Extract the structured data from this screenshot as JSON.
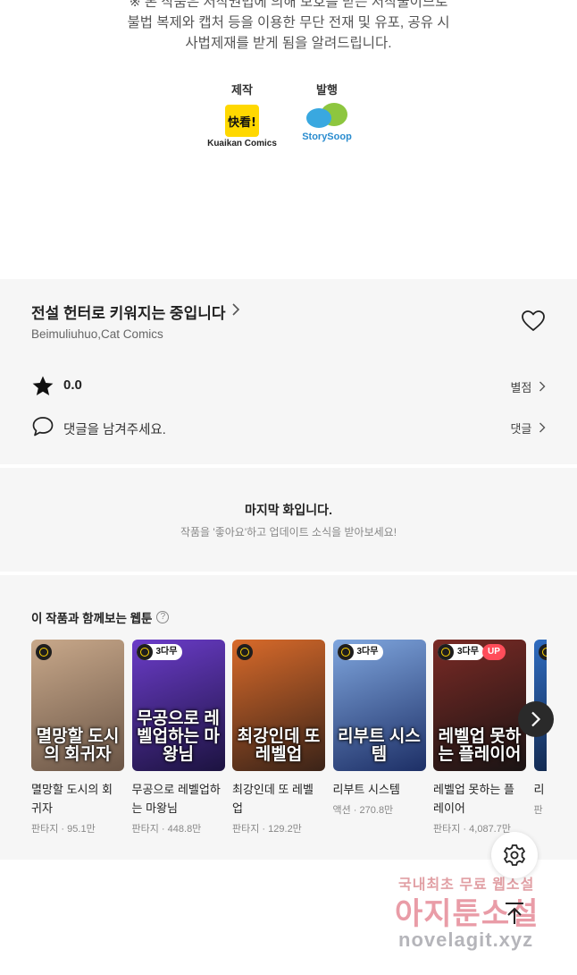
{
  "notice": {
    "lines": [
      "※ 본 작품은 저작권법에 의해 보호를 받는 저작물이므로",
      "불법 복제와 캡처 등을 이용한 무단 전재 및 유포, 공유 시",
      "사법제재를 받게 됨을 알려드립니다."
    ],
    "production_label": "제작",
    "production_logo_text": "快看!",
    "production_name": "Kuaikan Comics",
    "publisher_label": "발행",
    "publisher_name": "StorySoop"
  },
  "work": {
    "title": "전설 헌터로 키워지는 중입니다",
    "authors": "Beimuliuhuo,Cat Comics",
    "rating": "0.0",
    "rate_link": "별점",
    "comment_prompt": "댓글을 남겨주세요.",
    "comment_link": "댓글"
  },
  "last_episode": {
    "title": "마지막 화입니다.",
    "subtitle": "작품을 '좋아요'하고 업데이트 소식을 받아보세요!"
  },
  "recommendations": {
    "heading": "이 작품과 함께보는 웹툰",
    "items": [
      {
        "title": "멸망할 도시의 회귀자",
        "genre": "판타지",
        "views": "95.1만",
        "cover_text": "멸망할 도시의 회귀자",
        "badge": "",
        "up": "",
        "colors": [
          "#c8a88a",
          "#6a5546"
        ]
      },
      {
        "title": "무공으로 레벨업하는 마왕님",
        "genre": "판타지",
        "views": "448.8만",
        "cover_text": "무공으로 레벨업하는 마왕님",
        "badge": "3다무",
        "up": "",
        "colors": [
          "#6b3cc9",
          "#1c1340"
        ]
      },
      {
        "title": "최강인데 또 레벨업",
        "genre": "판타지",
        "views": "129.2만",
        "cover_text": "최강인데 또 레벨업",
        "badge": "",
        "up": "",
        "colors": [
          "#d86a2a",
          "#3a2318"
        ]
      },
      {
        "title": "리부트 시스템",
        "genre": "액션",
        "views": "270.8만",
        "cover_text": "리부트 시스템",
        "badge": "3다무",
        "up": "",
        "colors": [
          "#7fa6de",
          "#1d2f66"
        ]
      },
      {
        "title": "레벨업 못하는 플레이어",
        "genre": "판타지",
        "views": "4,087.7만",
        "cover_text": "레벨업 못하는 플레이어",
        "badge": "3다무",
        "up": "UP",
        "colors": [
          "#7a2a25",
          "#1a1414"
        ]
      },
      {
        "title": "리",
        "genre": "판",
        "views": "",
        "cover_text": "",
        "badge": "",
        "up": "",
        "colors": [
          "#2f6cc0",
          "#0e1d3b"
        ]
      }
    ]
  },
  "watermark": {
    "line1": "국내최초 무료 웹소설",
    "line2": "아지툰소설",
    "line3": "novelagit.xyz"
  },
  "colors": {
    "background": "#ffffff",
    "panel": "#f6f6f6",
    "text_primary": "#222222",
    "text_secondary": "#888888",
    "up_badge": "#ff4d5a",
    "clock_badge": "#ffd400"
  }
}
